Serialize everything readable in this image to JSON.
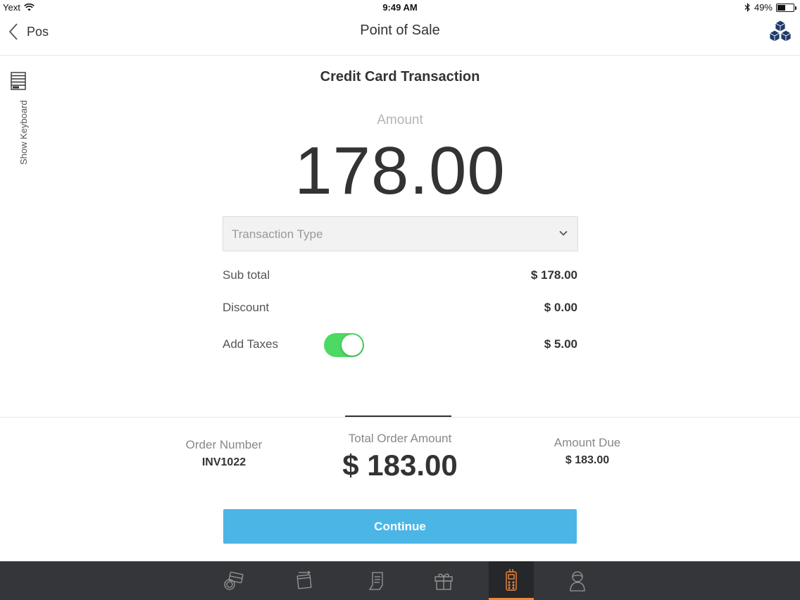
{
  "status_bar": {
    "carrier": "Yext",
    "time": "9:49 AM",
    "battery": "49%",
    "battery_level": 0.49
  },
  "nav": {
    "back_label": "Pos",
    "title": "Point of Sale",
    "logo_icon": "cubes-logo-icon"
  },
  "keyboard_toggle": {
    "label": "Show Keyboard"
  },
  "transaction": {
    "title": "Credit Card Transaction",
    "amount_label": "Amount",
    "amount": "178.00",
    "type_placeholder": "Transaction Type"
  },
  "lines": {
    "subtotal_label": "Sub total",
    "subtotal_value": "$ 178.00",
    "discount_label": "Discount",
    "discount_value": "$ 0.00",
    "taxes_label": "Add Taxes",
    "taxes_value": "$ 5.00",
    "taxes_enabled": true
  },
  "summary": {
    "order_number_label": "Order Number",
    "order_number": "INV1022",
    "total_label": "Total Order Amount",
    "total": "$ 183.00",
    "due_label": "Amount Due",
    "due": "$ 183.00"
  },
  "continue_label": "Continue",
  "colors": {
    "primary_button": "#4bb6e6",
    "toggle_on": "#4cd964",
    "tab_bar": "#35363a",
    "tab_active_accent": "#f0883a",
    "logo": "#1f3a6b"
  },
  "tabs": [
    {
      "icon": "card-payment-icon",
      "active": false
    },
    {
      "icon": "card-swipe-icon",
      "active": false
    },
    {
      "icon": "receipt-icon",
      "active": false
    },
    {
      "icon": "gift-icon",
      "active": false
    },
    {
      "icon": "card-terminal-icon",
      "active": true
    },
    {
      "icon": "customer-icon",
      "active": false
    }
  ]
}
